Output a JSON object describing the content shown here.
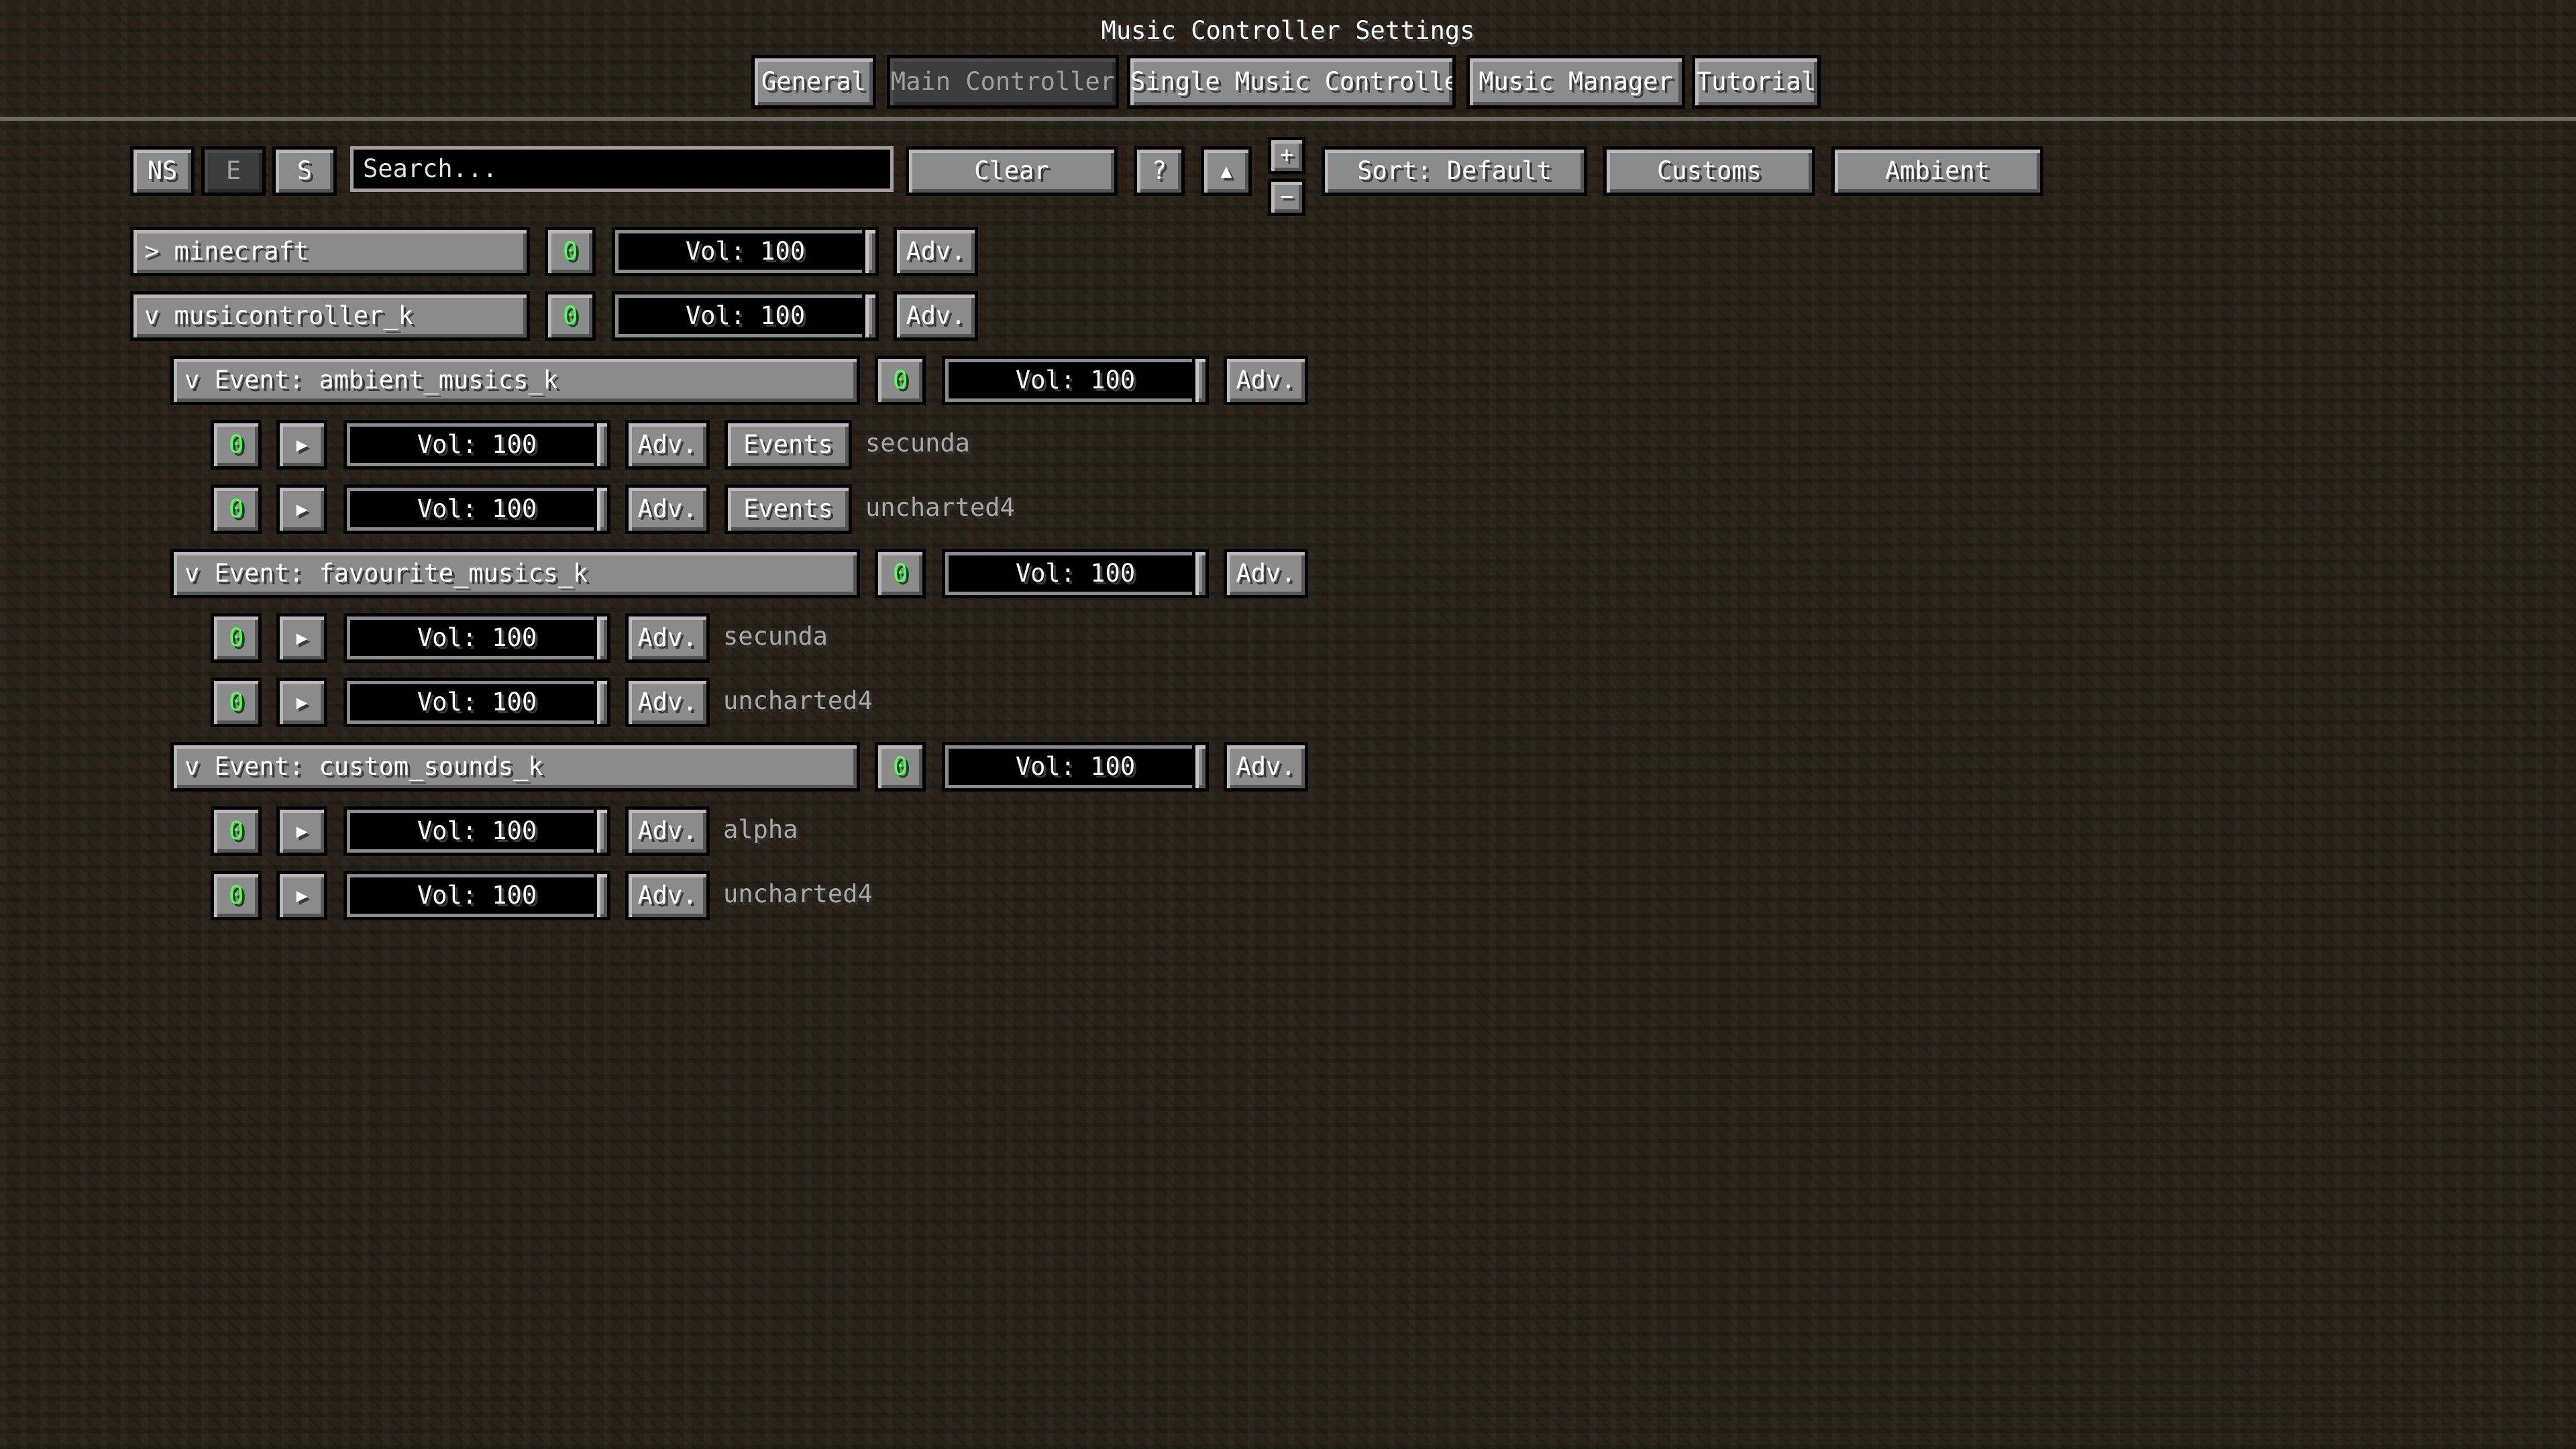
{
  "window": {
    "title": "Music Controller Settings"
  },
  "tabs": [
    {
      "label": "General",
      "active": false
    },
    {
      "label": "Main Controller",
      "active": true
    },
    {
      "label": "Single Music Controller",
      "active": false
    },
    {
      "label": "Music Manager",
      "active": false
    },
    {
      "label": "Tutorial",
      "active": false
    }
  ],
  "toolbar": {
    "ns": "NS",
    "e": "E",
    "s": "S",
    "search_placeholder": "Search...",
    "clear": "Clear",
    "help": "?",
    "up": "▲",
    "plus": "+",
    "minus": "−",
    "sort": "Sort: Default",
    "customs": "Customs",
    "ambient": "Ambient"
  },
  "namespaces": [
    {
      "name": "> minecraft",
      "count": "0",
      "volume": "Vol: 100",
      "adv": "Adv."
    },
    {
      "name": "v musicontroller_k",
      "count": "0",
      "volume": "Vol: 100",
      "adv": "Adv."
    }
  ],
  "events": [
    {
      "name": "v Event: ambient_musics_k",
      "count": "0",
      "volume": "Vol: 100",
      "adv": "Adv.",
      "tracks": [
        {
          "count": "0",
          "play": "▶",
          "volume": "Vol: 100",
          "adv": "Adv.",
          "events": "Events",
          "name": "secunda"
        },
        {
          "count": "0",
          "play": "▶",
          "volume": "Vol: 100",
          "adv": "Adv.",
          "events": "Events",
          "name": "uncharted4"
        }
      ]
    },
    {
      "name": "v Event: favourite_musics_k",
      "count": "0",
      "volume": "Vol: 100",
      "adv": "Adv.",
      "tracks": [
        {
          "count": "0",
          "play": "▶",
          "volume": "Vol: 100",
          "adv": "Adv.",
          "name": "secunda"
        },
        {
          "count": "0",
          "play": "▶",
          "volume": "Vol: 100",
          "adv": "Adv.",
          "name": "uncharted4"
        }
      ]
    },
    {
      "name": "v Event: custom_sounds_k",
      "count": "0",
      "volume": "Vol: 100",
      "adv": "Adv.",
      "tracks": [
        {
          "count": "0",
          "play": "▶",
          "volume": "Vol: 100",
          "adv": "Adv.",
          "name": "alpha"
        },
        {
          "count": "0",
          "play": "▶",
          "volume": "Vol: 100",
          "adv": "Adv.",
          "name": "uncharted4"
        }
      ]
    }
  ],
  "colors": {
    "count_green": "#55ff55",
    "button_gray": "#8b8b8b",
    "background_dirt": "#2a2219"
  }
}
